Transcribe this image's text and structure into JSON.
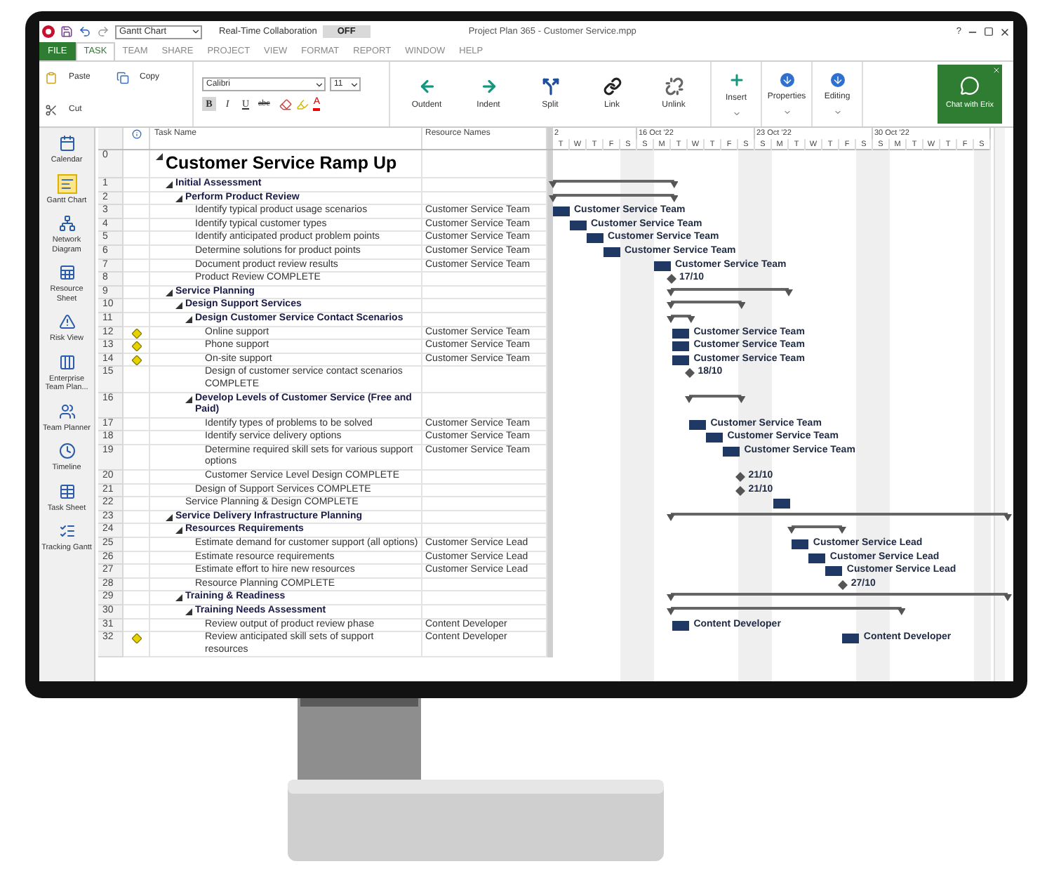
{
  "app": {
    "title": "Project Plan 365 - Customer Service.mpp",
    "view_selector": "Gantt Chart",
    "collaboration": {
      "label": "Real-Time Collaboration",
      "on": false,
      "state_text": "OFF"
    },
    "help": "?"
  },
  "menu_tabs": [
    {
      "label": "FILE",
      "kind": "file",
      "selected": false
    },
    {
      "label": "TASK",
      "kind": "tab",
      "selected": true
    },
    {
      "label": "TEAM",
      "kind": "tab",
      "selected": false
    },
    {
      "label": "SHARE",
      "kind": "tab",
      "selected": false
    },
    {
      "label": "PROJECT",
      "kind": "tab",
      "selected": false
    },
    {
      "label": "VIEW",
      "kind": "tab",
      "selected": false
    },
    {
      "label": "FORMAT",
      "kind": "tab",
      "selected": false
    },
    {
      "label": "REPORT",
      "kind": "tab",
      "selected": false
    },
    {
      "label": "WINDOW",
      "kind": "tab",
      "selected": false
    },
    {
      "label": "HELP",
      "kind": "tab",
      "selected": false
    }
  ],
  "ribbon": {
    "clipboard": [
      {
        "kind": "paste",
        "label": "Paste"
      },
      {
        "kind": "copy",
        "label": "Copy"
      },
      {
        "kind": "cut",
        "label": "Cut"
      }
    ],
    "font": {
      "family": "Calibri",
      "size": "11",
      "styles": [
        {
          "label": "B",
          "selected": true
        },
        {
          "label": "I",
          "selected": false
        },
        {
          "label": "U",
          "selected": false
        },
        {
          "label": "abc",
          "selected": false
        }
      ],
      "color_label": "A"
    },
    "commands": [
      {
        "kind": "outdent",
        "label": "Outdent"
      },
      {
        "kind": "indent",
        "label": "Indent"
      },
      {
        "kind": "split",
        "label": "Split"
      },
      {
        "kind": "link",
        "label": "Link"
      },
      {
        "kind": "unlink",
        "label": "Unlink"
      }
    ],
    "menus": [
      {
        "kind": "insert",
        "label": "Insert"
      },
      {
        "kind": "properties",
        "label": "Properties"
      },
      {
        "kind": "editing",
        "label": "Editing"
      }
    ],
    "chat": {
      "label": "Chat with Erix"
    }
  },
  "views": [
    {
      "kind": "calendar",
      "label": "Calendar",
      "selected": false
    },
    {
      "kind": "gantt",
      "label": "Gantt Chart",
      "selected": true
    },
    {
      "kind": "network",
      "label": "Network Diagram",
      "selected": false
    },
    {
      "kind": "resource",
      "label": "Resource Sheet",
      "selected": false
    },
    {
      "kind": "risk",
      "label": "Risk View",
      "selected": false
    },
    {
      "kind": "enterprise",
      "label": "Enterprise Team Plan...",
      "selected": false
    },
    {
      "kind": "team",
      "label": "Team Planner",
      "selected": false
    },
    {
      "kind": "timeline",
      "label": "Timeline",
      "selected": false
    },
    {
      "kind": "sheet",
      "label": "Task Sheet",
      "selected": false
    },
    {
      "kind": "tracking",
      "label": "Tracking Gantt",
      "selected": false
    }
  ],
  "columns": {
    "task": "Task Name",
    "resource": "Resource Names"
  },
  "timeline": {
    "weeks": [
      {
        "label": "2",
        "days": [
          {
            "label": "T",
            "weekend": false
          },
          {
            "label": "W",
            "weekend": false
          },
          {
            "label": "T",
            "weekend": false
          },
          {
            "label": "F",
            "weekend": false
          },
          {
            "label": "S",
            "weekend": true
          }
        ]
      },
      {
        "label": "16 Oct '22",
        "days": [
          {
            "label": "S",
            "weekend": true
          },
          {
            "label": "M",
            "weekend": false
          },
          {
            "label": "T",
            "weekend": false
          },
          {
            "label": "W",
            "weekend": false
          },
          {
            "label": "T",
            "weekend": false
          },
          {
            "label": "F",
            "weekend": false
          },
          {
            "label": "S",
            "weekend": true
          }
        ]
      },
      {
        "label": "23 Oct '22",
        "days": [
          {
            "label": "S",
            "weekend": true
          },
          {
            "label": "M",
            "weekend": false
          },
          {
            "label": "T",
            "weekend": false
          },
          {
            "label": "W",
            "weekend": false
          },
          {
            "label": "T",
            "weekend": false
          },
          {
            "label": "F",
            "weekend": false
          },
          {
            "label": "S",
            "weekend": true
          }
        ]
      },
      {
        "label": "30 Oct '22",
        "days": [
          {
            "label": "S",
            "weekend": true
          },
          {
            "label": "M",
            "weekend": false
          },
          {
            "label": "T",
            "weekend": false
          },
          {
            "label": "W",
            "weekend": false
          },
          {
            "label": "T",
            "weekend": false
          },
          {
            "label": "F",
            "weekend": false
          },
          {
            "label": "S",
            "weekend": true
          }
        ]
      }
    ]
  },
  "tasks": [
    {
      "id": "0",
      "name": "Customer Service Ramp Up",
      "warning": false,
      "expanded": true,
      "children": [
        {
          "id": "1",
          "name": "Initial Assessment",
          "warning": false,
          "expanded": true,
          "gantt": {
            "kind": "summary"
          },
          "children": [
            {
              "id": "2",
              "name": "Perform Product Review",
              "warning": false,
              "expanded": true,
              "gantt": {
                "kind": "summary"
              },
              "children": [
                {
                  "id": "3",
                  "name": "Identify typical product usage scenarios",
                  "resource": "Customer Service Team",
                  "warning": false,
                  "gantt": {
                    "kind": "task",
                    "label": "Customer Service Team"
                  }
                },
                {
                  "id": "4",
                  "name": "Identify typical customer types",
                  "resource": "Customer Service Team",
                  "warning": false,
                  "gantt": {
                    "kind": "task",
                    "label": "Customer Service Team"
                  }
                },
                {
                  "id": "5",
                  "name": "Identify anticipated product problem points",
                  "resource": "Customer Service Team",
                  "warning": false,
                  "gantt": {
                    "kind": "task",
                    "label": "Customer Service Team"
                  }
                },
                {
                  "id": "6",
                  "name": "Determine solutions for product points",
                  "resource": "Customer Service Team",
                  "warning": false,
                  "gantt": {
                    "kind": "task",
                    "label": "Customer Service Team"
                  }
                },
                {
                  "id": "7",
                  "name": "Document product review results",
                  "resource": "Customer Service Team",
                  "warning": false,
                  "gantt": {
                    "kind": "task",
                    "label": "Customer Service Team"
                  }
                },
                {
                  "id": "8",
                  "name": "Product Review COMPLETE",
                  "warning": false,
                  "gantt": {
                    "kind": "milestone",
                    "label": "17/10"
                  }
                }
              ]
            }
          ]
        },
        {
          "id": "9",
          "name": "Service Planning",
          "warning": false,
          "expanded": true,
          "gantt": {
            "kind": "summary"
          },
          "children": [
            {
              "id": "10",
              "name": "Design Support Services",
              "warning": false,
              "expanded": true,
              "gantt": {
                "kind": "summary"
              },
              "children": [
                {
                  "id": "11",
                  "name": "Design Customer Service Contact Scenarios",
                  "warning": false,
                  "expanded": true,
                  "gantt": {
                    "kind": "summary"
                  },
                  "children": [
                    {
                      "id": "12",
                      "name": "Online support",
                      "resource": "Customer Service Team",
                      "warning": true,
                      "gantt": {
                        "kind": "task",
                        "label": "Customer Service Team"
                      }
                    },
                    {
                      "id": "13",
                      "name": "Phone support",
                      "resource": "Customer Service Team",
                      "warning": true,
                      "gantt": {
                        "kind": "task",
                        "label": "Customer Service Team"
                      }
                    },
                    {
                      "id": "14",
                      "name": "On-site support",
                      "resource": "Customer Service Team",
                      "warning": true,
                      "gantt": {
                        "kind": "task",
                        "label": "Customer Service Team"
                      }
                    },
                    {
                      "id": "15",
                      "name": "Design of customer service contact scenarios COMPLETE",
                      "warning": false,
                      "gantt": {
                        "kind": "milestone",
                        "label": "18/10"
                      }
                    }
                  ]
                },
                {
                  "id": "16",
                  "name": "Develop Levels of Customer Service (Free and Paid)",
                  "warning": false,
                  "expanded": true,
                  "gantt": {
                    "kind": "summary"
                  },
                  "children": [
                    {
                      "id": "17",
                      "name": "Identify types of problems to be solved",
                      "resource": "Customer Service Team",
                      "warning": false,
                      "gantt": {
                        "kind": "task",
                        "label": "Customer Service Team"
                      }
                    },
                    {
                      "id": "18",
                      "name": "Identify service delivery options",
                      "resource": "Customer Service Team",
                      "warning": false,
                      "gantt": {
                        "kind": "task",
                        "label": "Customer Service Team"
                      }
                    },
                    {
                      "id": "19",
                      "name": "Determine required skill sets for various support options",
                      "resource": "Customer Service Team",
                      "warning": false,
                      "gantt": {
                        "kind": "task",
                        "label": "Customer Service Team"
                      }
                    },
                    {
                      "id": "20",
                      "name": "Customer Service Level Design COMPLETE",
                      "warning": false,
                      "gantt": {
                        "kind": "milestone",
                        "label": "21/10"
                      }
                    }
                  ]
                },
                {
                  "id": "21",
                  "name": "Design of Support Services COMPLETE",
                  "warning": false,
                  "gantt": {
                    "kind": "milestone",
                    "label": "21/10"
                  }
                }
              ]
            },
            {
              "id": "22",
              "name": "Service Planning & Design COMPLETE",
              "warning": false,
              "gantt": {
                "kind": "task"
              }
            }
          ]
        },
        {
          "id": "23",
          "name": "Service Delivery Infrastructure Planning",
          "warning": false,
          "expanded": true,
          "gantt": {
            "kind": "summary"
          },
          "children": [
            {
              "id": "24",
              "name": "Resources Requirements",
              "warning": false,
              "expanded": true,
              "gantt": {
                "kind": "summary"
              },
              "children": [
                {
                  "id": "25",
                  "name": "Estimate demand for customer support (all options)",
                  "resource": "Customer Service Lead",
                  "warning": false,
                  "gantt": {
                    "kind": "task",
                    "label": "Customer Service Lead"
                  }
                },
                {
                  "id": "26",
                  "name": "Estimate resource requirements",
                  "resource": "Customer Service Lead",
                  "warning": false,
                  "gantt": {
                    "kind": "task",
                    "label": "Customer Service Lead"
                  }
                },
                {
                  "id": "27",
                  "name": "Estimate effort to hire new resources",
                  "resource": "Customer Service Lead",
                  "warning": false,
                  "gantt": {
                    "kind": "task",
                    "label": "Customer Service Lead"
                  }
                },
                {
                  "id": "28",
                  "name": "Resource Planning COMPLETE",
                  "warning": false,
                  "gantt": {
                    "kind": "milestone",
                    "label": "27/10"
                  }
                }
              ]
            },
            {
              "id": "29",
              "name": "Training & Readiness",
              "warning": false,
              "expanded": true,
              "gantt": {
                "kind": "summary"
              },
              "children": [
                {
                  "id": "30",
                  "name": "Training Needs Assessment",
                  "warning": false,
                  "expanded": true,
                  "gantt": {
                    "kind": "summary"
                  },
                  "children": [
                    {
                      "id": "31",
                      "name": "Review output of product review phase",
                      "resource": "Content Developer",
                      "warning": false,
                      "gantt": {
                        "kind": "task",
                        "label": "Content Developer"
                      }
                    },
                    {
                      "id": "32",
                      "name": "Review anticipated skill sets of support resources",
                      "resource": "Content Developer",
                      "warning": true,
                      "gantt": {
                        "kind": "task",
                        "label": "Content Developer"
                      }
                    }
                  ]
                }
              ]
            }
          ]
        }
      ]
    }
  ]
}
